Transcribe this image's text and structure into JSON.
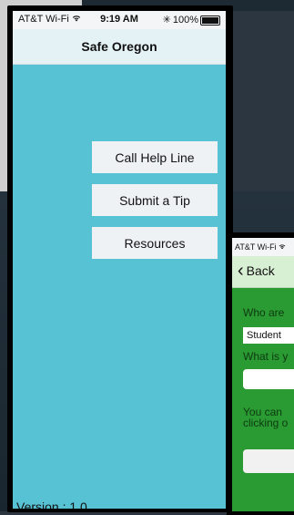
{
  "main_phone": {
    "status_bar": {
      "carrier": "AT&T Wi-Fi",
      "time": "9:19 AM",
      "battery": "100%"
    },
    "nav_title": "Safe Oregon",
    "buttons": [
      {
        "label": "Call Help Line"
      },
      {
        "label": "Submit a Tip"
      },
      {
        "label": "Resources"
      }
    ],
    "version": "Version : 1.0"
  },
  "second_phone": {
    "status_bar": {
      "carrier": "AT&T Wi-Fi"
    },
    "back_label": "Back",
    "question_1": "Who are",
    "student_value": "Student",
    "question_2": "What is y",
    "info_line_1": "You can",
    "info_line_2": "clicking o"
  },
  "colors": {
    "main_background": "#58c2d5",
    "main_nav": "#e4f2f6",
    "second_background": "#2a9a33",
    "second_nav": "#d7f0d3"
  },
  "icons": [
    "wifi-icon",
    "bluetooth-icon",
    "battery-icon",
    "chevron-left-icon"
  ]
}
